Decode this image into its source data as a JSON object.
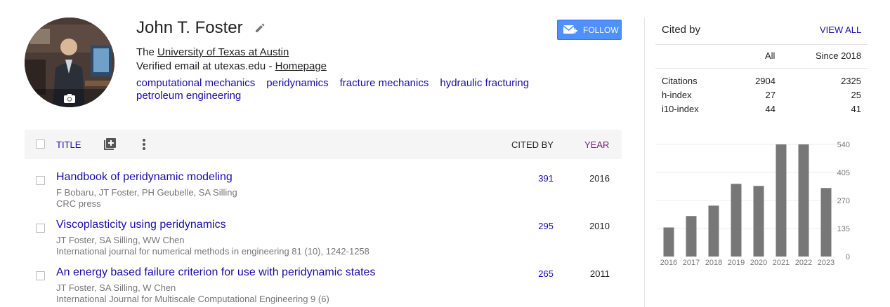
{
  "profile": {
    "name": "John T. Foster",
    "affiliation_prefix": "The",
    "affiliation": "University of Texas at Austin",
    "email_text": "Verified email at utexas.edu -",
    "homepage": "Homepage",
    "interests": [
      "computational mechanics",
      "peridynamics",
      "fracture mechanics",
      "hydraulic fracturing",
      "petroleum engineering"
    ],
    "follow_label": "FOLLOW"
  },
  "table": {
    "header": {
      "title": "TITLE",
      "cited_by": "CITED BY",
      "year": "YEAR"
    },
    "rows": [
      {
        "title": "Handbook of peridynamic modeling",
        "authors": "F Bobaru, JT Foster, PH Geubelle, SA Silling",
        "venue": "CRC press",
        "cited_by": "391",
        "year": "2016"
      },
      {
        "title": "Viscoplasticity using peridynamics",
        "authors": "JT Foster, SA Silling, WW Chen",
        "venue": "International journal for numerical methods in engineering 81 (10), 1242-1258",
        "cited_by": "295",
        "year": "2010"
      },
      {
        "title": "An energy based failure criterion for use with peridynamic states",
        "authors": "JT Foster, SA Silling, W Chen",
        "venue": "International Journal for Multiscale Computational Engineering 9 (6)",
        "cited_by": "265",
        "year": "2011"
      }
    ]
  },
  "cited_by": {
    "title": "Cited by",
    "view_all": "VIEW ALL",
    "col_all": "All",
    "col_since": "Since 2018",
    "metrics": [
      {
        "label": "Citations",
        "all": "2904",
        "since": "2325"
      },
      {
        "label": "h-index",
        "all": "27",
        "since": "25"
      },
      {
        "label": "i10-index",
        "all": "44",
        "since": "41"
      }
    ]
  },
  "chart_data": {
    "type": "bar",
    "categories": [
      "2016",
      "2017",
      "2018",
      "2019",
      "2020",
      "2021",
      "2022",
      "2023"
    ],
    "values": [
      140,
      195,
      245,
      350,
      340,
      540,
      540,
      330
    ],
    "yticks": [
      0,
      135,
      270,
      405,
      540
    ],
    "ylim": [
      0,
      540
    ],
    "bar_color": "#777777"
  },
  "colors": {
    "link": "#1a0dab",
    "year_header": "#77216f",
    "follow_bg": "#4d90fe"
  }
}
